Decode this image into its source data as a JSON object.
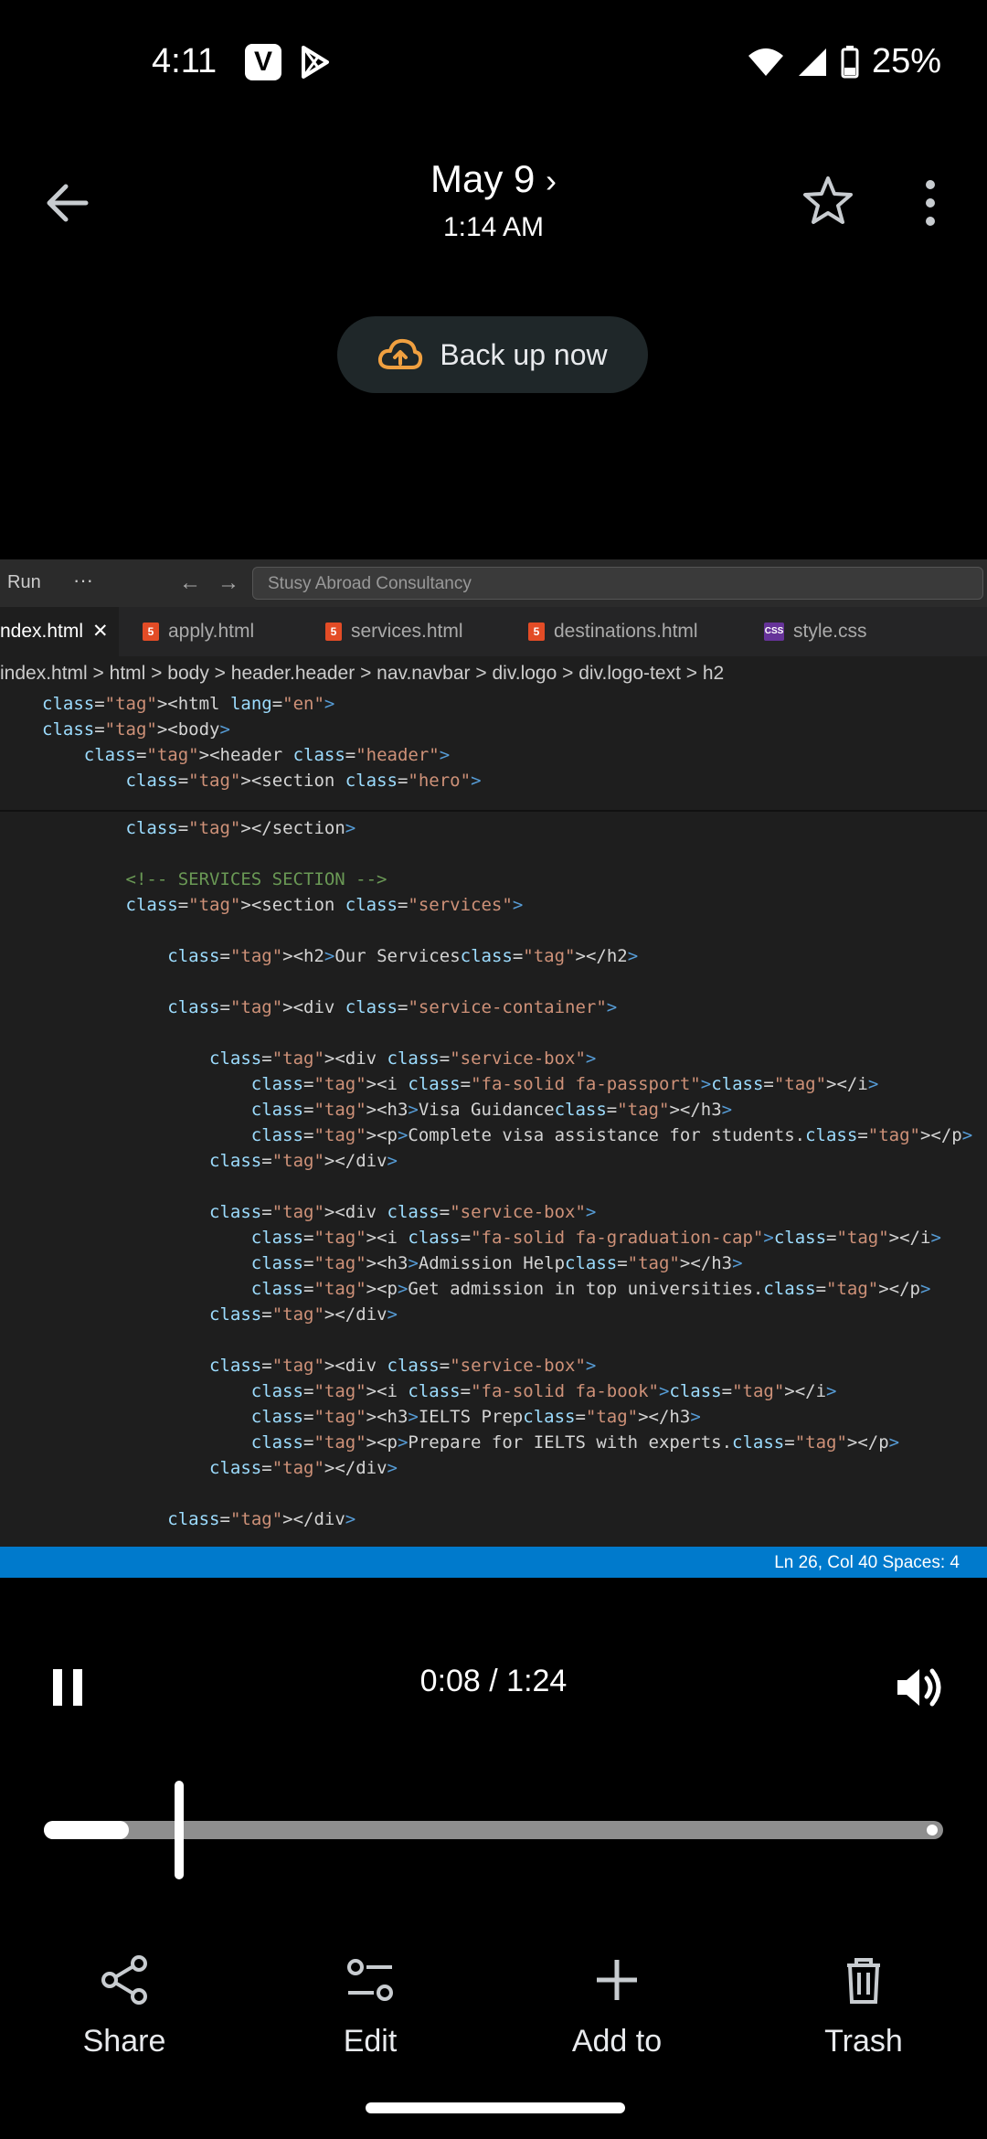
{
  "status_bar": {
    "time": "4:11",
    "battery": "25%",
    "left_icons": [
      "v-app-icon",
      "play-store-icon"
    ],
    "right_icons": [
      "wifi-icon",
      "signal-icon",
      "battery-icon"
    ]
  },
  "header": {
    "date": "May 9",
    "time": "1:14 AM"
  },
  "backup": {
    "label": "Back up now"
  },
  "editor": {
    "run": "Run",
    "search": "Stusy Abroad Consultancy",
    "tabs": [
      "ndex.html",
      "apply.html",
      "services.html",
      "destinations.html",
      "style.css"
    ],
    "breadcrumb": [
      "index.html",
      "html",
      "body",
      "header.header",
      "nav.navbar",
      "div.logo",
      "div.logo-text",
      "h2"
    ],
    "status": "Ln 26, Col 40    Spaces: 4",
    "sticky_lines": [
      "<html lang=\"en\">",
      "<body>",
      "    <header class=\"header\">",
      "        <section class=\"hero\">"
    ],
    "lines": [
      "        </section>",
      "",
      "        <!-- SERVICES SECTION -->",
      "        <section class=\"services\">",
      "",
      "            <h2>Our Services</h2>",
      "",
      "            <div class=\"service-container\">",
      "",
      "                <div class=\"service-box\">",
      "                    <i class=\"fa-solid fa-passport\"></i>",
      "                    <h3>Visa Guidance</h3>",
      "                    <p>Complete visa assistance for students.</p>",
      "                </div>",
      "",
      "                <div class=\"service-box\">",
      "                    <i class=\"fa-solid fa-graduation-cap\"></i>",
      "                    <h3>Admission Help</h3>",
      "                    <p>Get admission in top universities.</p>",
      "                </div>",
      "",
      "                <div class=\"service-box\">",
      "                    <i class=\"fa-solid fa-book\"></i>",
      "                    <h3>IELTS Prep</h3>",
      "                    <p>Prepare for IELTS with experts.</p>",
      "                </div>",
      "",
      "            </div>"
    ]
  },
  "player": {
    "time": "0:08 / 1:24",
    "progress": 0.095
  },
  "actions": {
    "share": "Share",
    "edit": "Edit",
    "add_to": "Add to",
    "trash": "Trash"
  }
}
